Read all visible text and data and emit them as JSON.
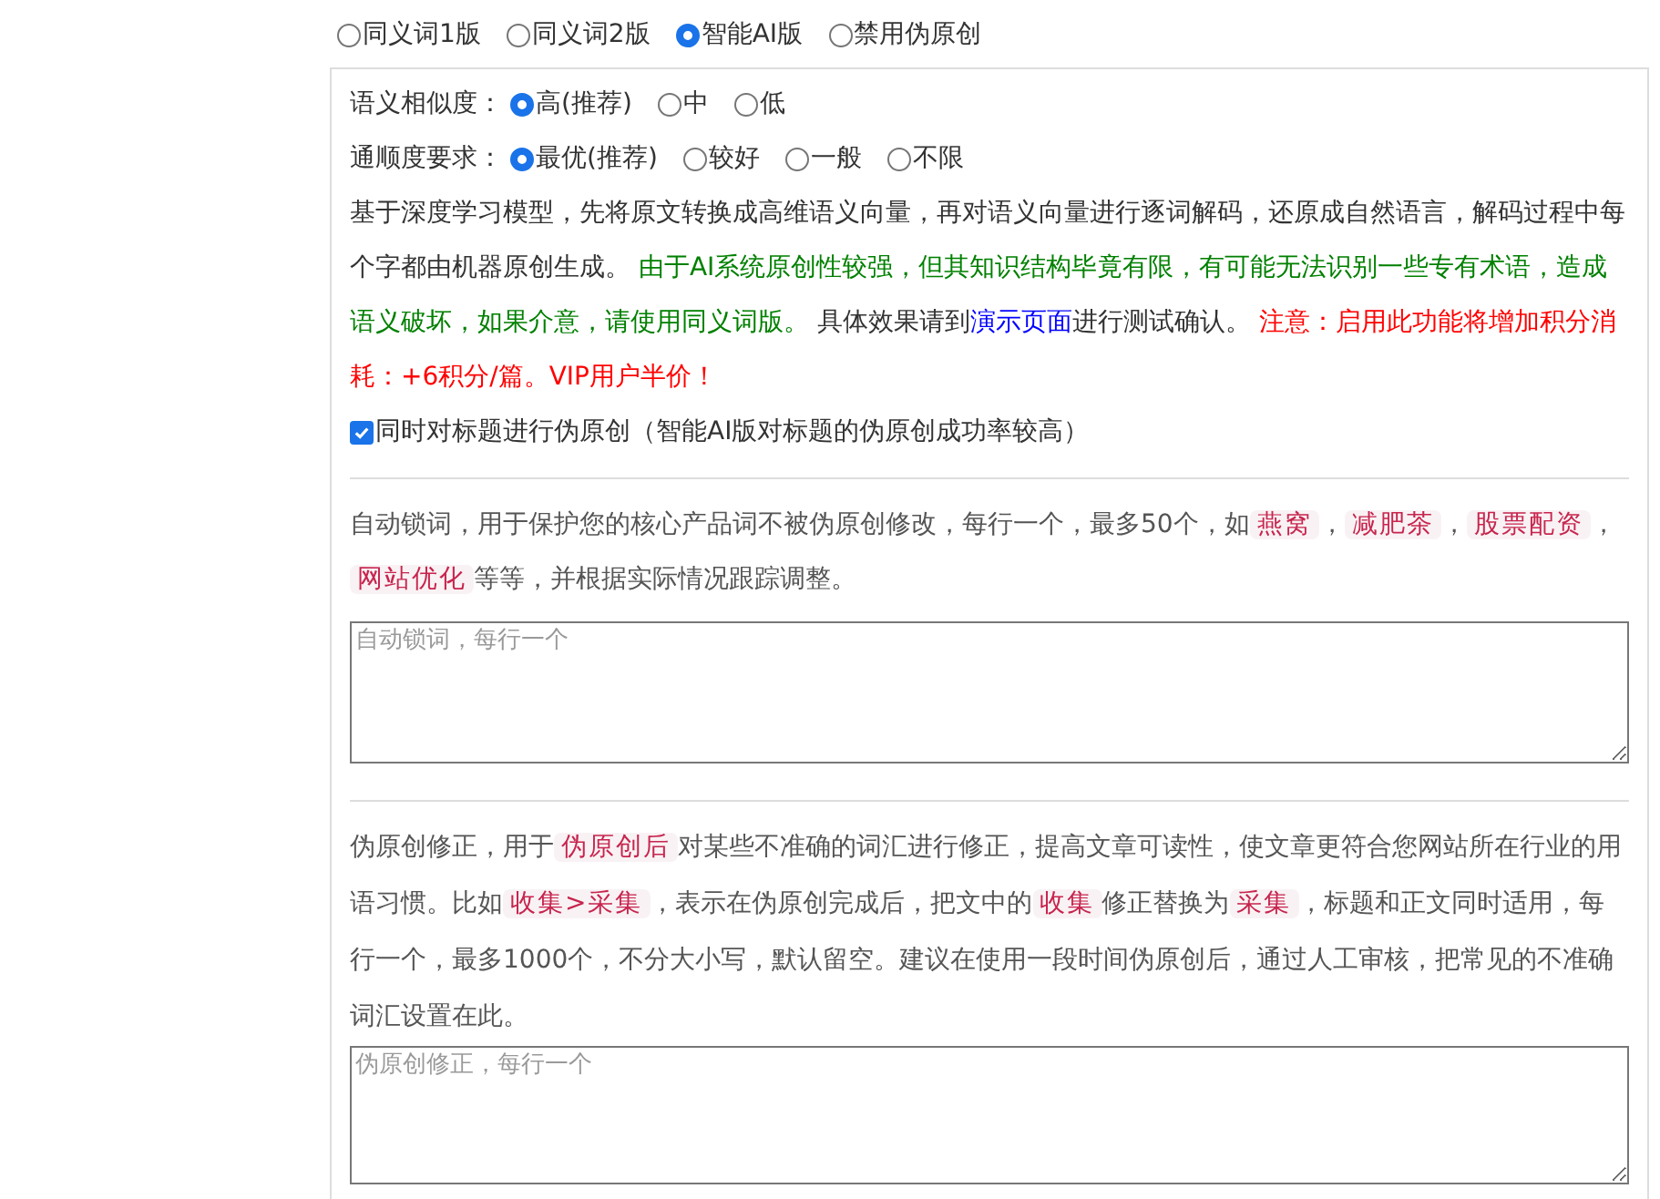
{
  "modes": [
    {
      "label": "同义词1版",
      "selected": false
    },
    {
      "label": "同义词2版",
      "selected": false
    },
    {
      "label": "智能AI版",
      "selected": true
    },
    {
      "label": "禁用伪原创",
      "selected": false
    }
  ],
  "similarity": {
    "label": "语义相似度：",
    "options": [
      {
        "label": "高(推荐)",
        "selected": true
      },
      {
        "label": "中",
        "selected": false
      },
      {
        "label": "低",
        "selected": false
      }
    ]
  },
  "fluency": {
    "label": "通顺度要求：",
    "options": [
      {
        "label": "最优(推荐)",
        "selected": true
      },
      {
        "label": "较好",
        "selected": false
      },
      {
        "label": "一般",
        "selected": false
      },
      {
        "label": "不限",
        "selected": false
      }
    ]
  },
  "ai_description": [
    {
      "kind": "text",
      "text": "基于深度学习模型，先将原文转换成高维语义向量，再对语义向量进行逐词解码，还原成自然语言，解码过程中每个字都由机器原创生成。 "
    },
    {
      "kind": "green",
      "text": "由于AI系统原创性较强，但其知识结构毕竟有限，有可能无法识别一些专有术语，造成语义破坏，如果介意，请使用同义词版。"
    },
    {
      "kind": "text",
      "text": " 具体效果请到"
    },
    {
      "kind": "link",
      "text": "演示页面"
    },
    {
      "kind": "text",
      "text": "进行测试确认。 "
    },
    {
      "kind": "red",
      "text": "注意：启用此功能将增加积分消耗：+6积分/篇。VIP用户半价！"
    }
  ],
  "title_option": {
    "label": "同时对标题进行伪原创（智能AI版对标题的伪原创成功率较高）",
    "checked": true
  },
  "lock_words": {
    "description": [
      {
        "kind": "text",
        "text": "自动锁词，用于保护您的核心产品词不被伪原创修改，每行一个，最多50个，如"
      },
      {
        "kind": "code",
        "text": "燕窝"
      },
      {
        "kind": "text",
        "text": "，"
      },
      {
        "kind": "code",
        "text": "减肥茶"
      },
      {
        "kind": "text",
        "text": "，"
      },
      {
        "kind": "code",
        "text": "股票配资"
      },
      {
        "kind": "text",
        "text": "，"
      },
      {
        "kind": "code",
        "text": "网站优化"
      },
      {
        "kind": "text",
        "text": "等等，并根据实际情况跟踪调整。"
      }
    ],
    "placeholder": "自动锁词，每行一个"
  },
  "corrections": {
    "description": [
      {
        "kind": "text",
        "text": "伪原创修正，用于"
      },
      {
        "kind": "code",
        "text": "伪原创后"
      },
      {
        "kind": "text",
        "text": "对某些不准确的词汇进行修正，提高文章可读性，使文章更符合您网站所在行业的用语习惯。比如"
      },
      {
        "kind": "code",
        "text": "收集>采集"
      },
      {
        "kind": "text",
        "text": "，表示在伪原创完成后，把文中的"
      },
      {
        "kind": "code",
        "text": "收集"
      },
      {
        "kind": "text",
        "text": "修正替换为"
      },
      {
        "kind": "code",
        "text": "采集"
      },
      {
        "kind": "text",
        "text": "，标题和正文同时适用，每行一个，最多1000个，不分大小写，默认留空。建议在使用一段时间伪原创后，通过人工审核，把常见的不准确词汇设置在此。"
      }
    ],
    "placeholder": "伪原创修正，每行一个"
  }
}
